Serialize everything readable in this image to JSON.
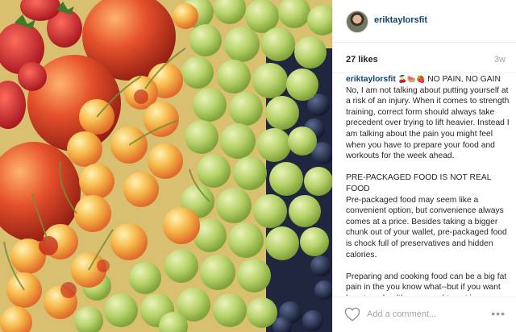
{
  "post": {
    "username": "eriktaylorsfit",
    "likes": "27 likes",
    "age": "3w",
    "caption": {
      "username": "eriktaylorsfit",
      "emojis": "🍒🍉🍓",
      "headline": "NO PAIN, NO GAIN",
      "para1": "No, I am not talking about putting yourself at a risk of an injury. When it comes to strength training, correct form should always take precedent over trying to lift heavier. Instead I am talking about the pain you might feel when you have to prepare your food and workouts for the week ahead.",
      "heading2": "PRE-PACKAGED FOOD IS NOT REAL FOOD",
      "para2": "Pre-packaged food may seem like a convenient option, but convenience always comes at a price. Besides taking a bigger chunk out of your wallet, pre-packaged food is chock full of preservatives and hidden calories.",
      "para3": "Preparing and cooking food can be a big fat pain in the you know what--but if you want long term health, you need to put in"
    }
  },
  "footer": {
    "comment_placeholder": "Add a comment...",
    "more_label": "•••"
  },
  "icons": {
    "like": "heart-icon",
    "more": "more-options-icon"
  },
  "colors": {
    "username_link": "#12436b",
    "muted_text": "#a5a5a5",
    "border": "#efefef"
  }
}
